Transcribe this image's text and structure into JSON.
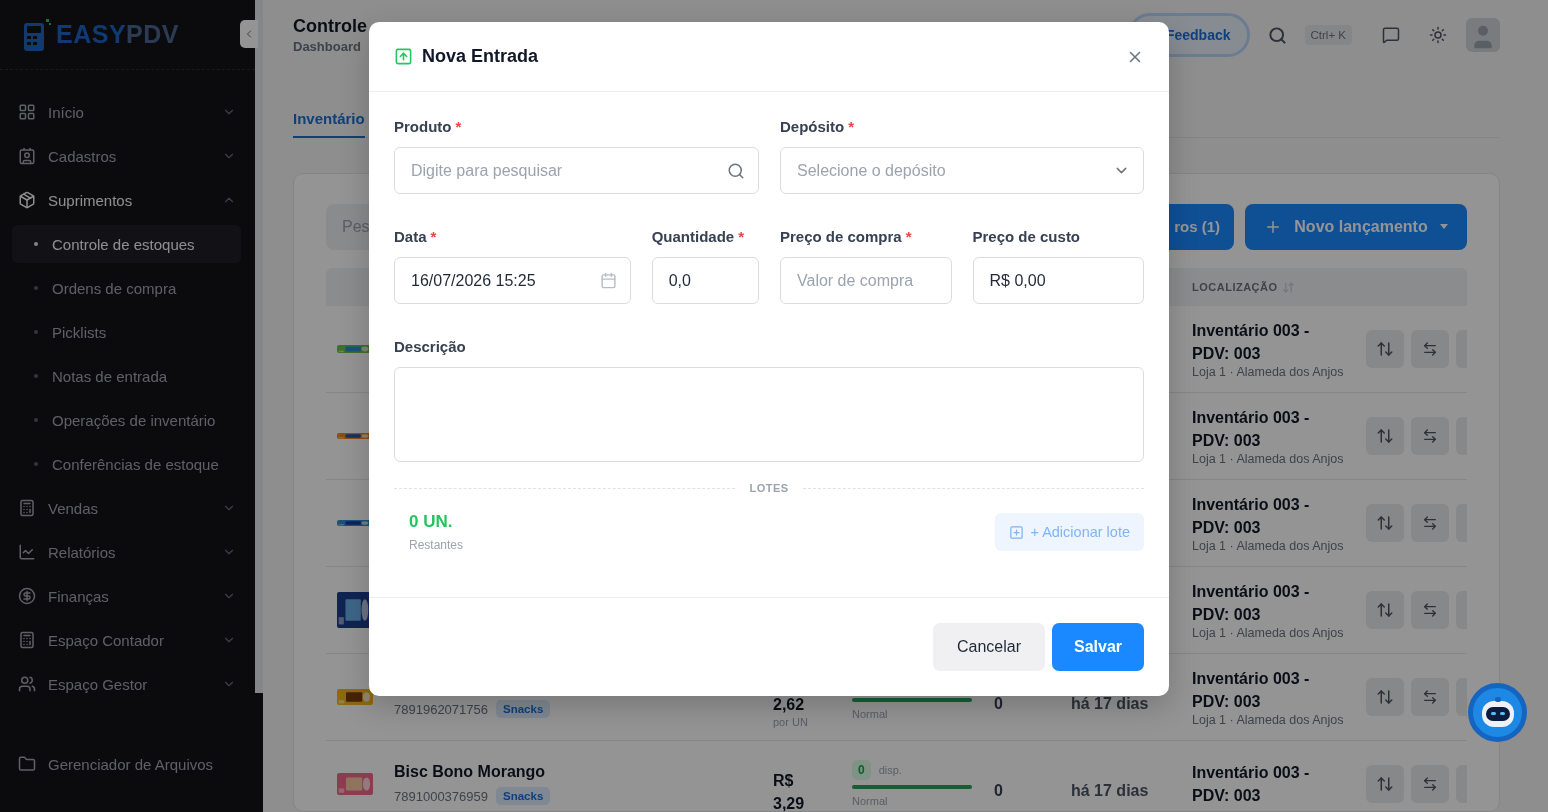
{
  "sidebar": {
    "logo": {
      "primary": "EASY",
      "secondary": "PDV"
    },
    "nav": [
      {
        "label": "Início",
        "expanded": false
      },
      {
        "label": "Cadastros",
        "expanded": false
      },
      {
        "label": "Suprimentos",
        "expanded": true,
        "children": [
          {
            "label": "Controle de estoques",
            "selected": true
          },
          {
            "label": "Ordens de compra",
            "selected": false
          },
          {
            "label": "Picklists",
            "selected": false
          },
          {
            "label": "Notas de entrada",
            "selected": false
          },
          {
            "label": "Operações de inventário",
            "selected": false
          },
          {
            "label": "Conferências de estoque",
            "selected": false
          }
        ]
      },
      {
        "label": "Vendas",
        "expanded": false
      },
      {
        "label": "Relatórios",
        "expanded": false
      },
      {
        "label": "Finanças",
        "expanded": false
      },
      {
        "label": "Espaço Contador",
        "expanded": false
      },
      {
        "label": "Espaço Gestor",
        "expanded": false
      }
    ],
    "footer_nav": [
      {
        "label": "Gerenciador de Arquivos"
      }
    ]
  },
  "header": {
    "title": "Controle",
    "breadcrumb": "Dashboard",
    "feedback": "Feedback",
    "shortcut": "Ctrl+ K"
  },
  "tabs": [
    {
      "label": "Inventário",
      "selected": true
    }
  ],
  "toolbar": {
    "search_placeholder": "Pes",
    "filter_button": "ros (1)",
    "new_button": "Novo lançamento"
  },
  "table": {
    "location_column": "LOCALIZAÇÃO",
    "rows": [
      {
        "location": {
          "name": "Inventário 003 - PDV: 003",
          "store": "Loja 1 · Alameda dos Anjos"
        }
      },
      {
        "location": {
          "name": "Inventário 003 - PDV: 003",
          "store": "Loja 1 · Alameda dos Anjos"
        }
      },
      {
        "location": {
          "name": "Inventário 003 - PDV: 003",
          "store": "Loja 1 · Alameda dos Anjos"
        }
      },
      {
        "location": {
          "name": "Inventário 003 - PDV: 003",
          "store": "Loja 1 · Alameda dos Anjos"
        }
      },
      {
        "code": "7891962071756",
        "tag": "Snacks",
        "price": {
          "value": "2,62",
          "unit": "por UN"
        },
        "stock": {
          "level": 1,
          "status": "Normal"
        },
        "quantity": "0",
        "date": "há 17 dias",
        "location": {
          "name": "Inventário 003 - PDV: 003",
          "store": "Loja 1 · Alameda dos Anjos"
        }
      },
      {
        "name": "Bisc Bono Morango",
        "code": "7891000376959",
        "tag": "Snacks",
        "price": {
          "currency": "R$",
          "value": "3,29"
        },
        "stock": {
          "available": "0",
          "available_label": "disp.",
          "level": 1,
          "status": "Normal"
        },
        "quantity": "0",
        "date": "há 17 dias",
        "location": {
          "name": "Inventário 003 - PDV: 003"
        }
      }
    ]
  },
  "modal": {
    "title": "Nova Entrada",
    "fields": [
      {
        "kind": "search",
        "label": "Produto",
        "required_mark": "*",
        "placeholder": "Digite para pesquisar"
      },
      {
        "kind": "select",
        "label": "Depósito",
        "required_mark": "*",
        "placeholder": "Selecione o depósito"
      },
      {
        "kind": "date",
        "label": "Data",
        "required_mark": "*",
        "value": "16/07/2026 15:25"
      },
      {
        "kind": "text",
        "label": "Quantidade",
        "required_mark": "*",
        "value": "0,0"
      },
      {
        "kind": "text",
        "label": "Preço de compra",
        "required_mark": "*",
        "placeholder": "Valor de compra"
      },
      {
        "kind": "text",
        "label": "Preço de custo",
        "value": "R$ 0,00"
      },
      {
        "kind": "textarea",
        "label": "Descrição"
      }
    ],
    "section_label": "LOTES",
    "remaining": {
      "value": "0 UN.",
      "label": "Restantes"
    },
    "add_batch": {
      "label": "+ Adicionar lote",
      "disabled": true
    },
    "cancel": "Cancelar",
    "save": "Salvar"
  }
}
